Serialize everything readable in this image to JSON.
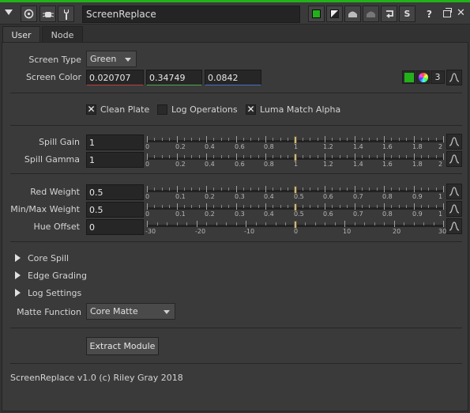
{
  "node": {
    "name": "ScreenReplace",
    "footer": "ScreenReplace v1.0 (c) Riley Gray 2018"
  },
  "titlebar": {
    "help_glyph": "?",
    "close_glyph": "✕",
    "s_glyph": "S"
  },
  "tabs": [
    {
      "label": "User",
      "active": true
    },
    {
      "label": "Node",
      "active": false
    }
  ],
  "screen_type": {
    "label": "Screen Type",
    "value": "Green"
  },
  "screen_color": {
    "label": "Screen Color",
    "r": "0.020707",
    "g": "0.34749",
    "b": "0.0842",
    "channels": "3",
    "swatch": "#22b11a"
  },
  "options": [
    {
      "label": "Clean Plate",
      "checked": true
    },
    {
      "label": "Log Operations",
      "checked": false
    },
    {
      "label": "Luma Match Alpha",
      "checked": true
    }
  ],
  "sliders": {
    "spill_gain": {
      "label": "Spill Gain",
      "value": "1",
      "min": 0,
      "max": 2,
      "v": 1,
      "ticks": [
        "0",
        "0.2",
        "0.4",
        "0.6",
        "0.8",
        "1",
        "1.2",
        "1.4",
        "1.6",
        "1.8",
        "2"
      ]
    },
    "spill_gamma": {
      "label": "Spill Gamma",
      "value": "1",
      "min": 0,
      "max": 2,
      "v": 1,
      "ticks": [
        "0",
        "0.2",
        "0.4",
        "0.6",
        "0.8",
        "1",
        "1.2",
        "1.4",
        "1.6",
        "1.8",
        "2"
      ]
    },
    "red_weight": {
      "label": "Red Weight",
      "value": "0.5",
      "min": 0,
      "max": 1,
      "v": 0.5,
      "ticks": [
        "0",
        "0.1",
        "0.2",
        "0.3",
        "0.4",
        "0.5",
        "0.6",
        "0.7",
        "0.8",
        "0.9",
        "1"
      ]
    },
    "minmax_weight": {
      "label": "Min/Max Weight",
      "value": "0.5",
      "min": 0,
      "max": 1,
      "v": 0.5,
      "ticks": [
        "0",
        "0.1",
        "0.2",
        "0.3",
        "0.4",
        "0.5",
        "0.6",
        "0.7",
        "0.8",
        "0.9",
        "1"
      ]
    },
    "hue_offset": {
      "label": "Hue Offset",
      "value": "0",
      "min": -30,
      "max": 30,
      "v": 0,
      "ticks": [
        "-30",
        "-20",
        "-10",
        "0",
        "10",
        "20",
        "30"
      ]
    }
  },
  "groups": [
    {
      "label": "Core Spill"
    },
    {
      "label": "Edge Grading"
    },
    {
      "label": "Log Settings"
    }
  ],
  "matte_function": {
    "label": "Matte Function",
    "value": "Core Matte"
  },
  "extract_button": "Extract Module"
}
